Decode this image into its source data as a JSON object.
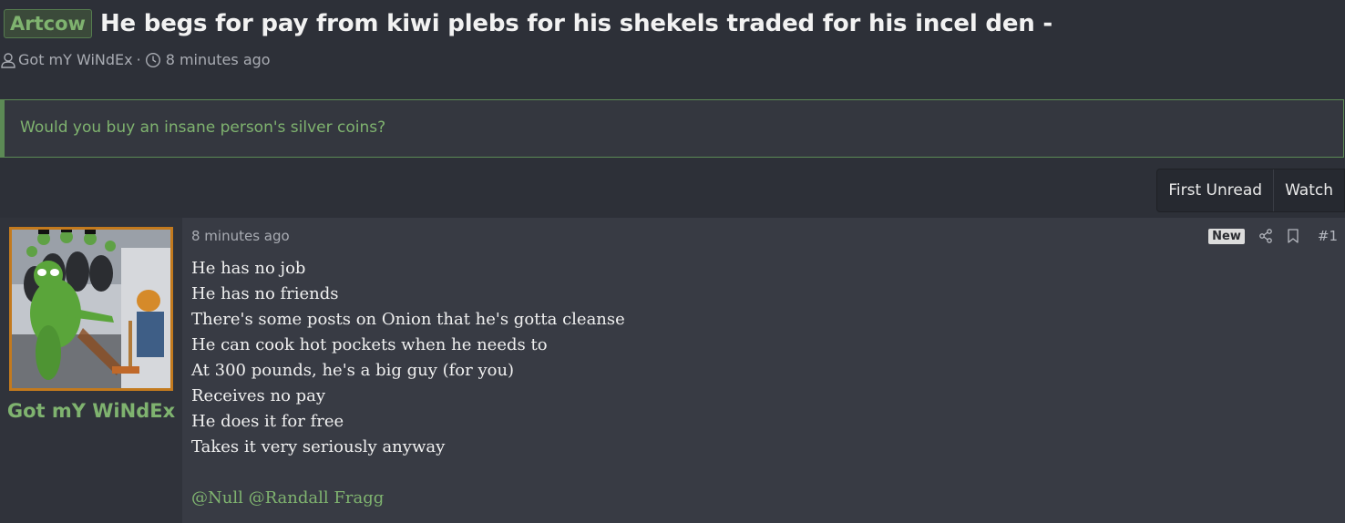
{
  "thread": {
    "prefix": "Artcow",
    "title": "He begs for pay from kiwi plebs for his shekels traded for his incel den -",
    "author": "Got mY WiNdEx",
    "meta_separator": "·",
    "time": "8 minutes ago"
  },
  "notice": {
    "text": "Would you buy an insane person's silver coins?"
  },
  "buttons": {
    "first_unread": "First Unread",
    "watch": "Watch"
  },
  "post": {
    "username": "Got mY WiNdEx",
    "date": "8 minutes ago",
    "badge": "New",
    "number": "#1",
    "lines": [
      "He has no job",
      "He has no friends",
      "There's some posts on Onion that he's gotta cleanse",
      "He can cook hot pockets when he needs to",
      "At 300 pounds, he's a big guy (for you)",
      "Receives no pay",
      "He does it for free",
      "Takes it very seriously anyway"
    ],
    "mentions": [
      "@Null",
      "@Randall Fragg"
    ]
  },
  "colors": {
    "accent_green": "#7fb36f",
    "avatar_border": "#c37a1e",
    "background": "#2d3038"
  },
  "icons": {
    "author": "user-icon",
    "time": "clock-icon",
    "share": "share-icon",
    "bookmark": "bookmark-icon"
  }
}
